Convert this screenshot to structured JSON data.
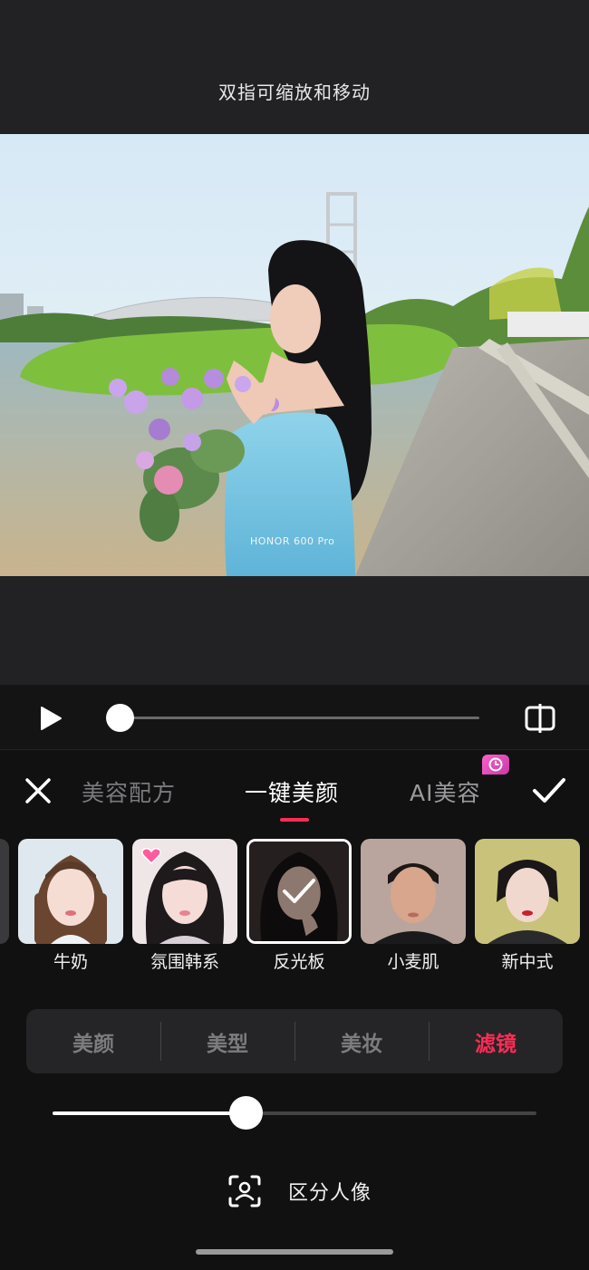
{
  "header": {
    "hint": "双指可缩放和移动"
  },
  "photo": {
    "watermark": "HONOR 600 Pro"
  },
  "playback": {
    "progress": 0.0
  },
  "tabs": [
    {
      "label": "美容配方",
      "active": false
    },
    {
      "label": "一键美颜",
      "active": true
    },
    {
      "label": "AI美容",
      "active": false,
      "badge_icon": "clock-icon"
    }
  ],
  "presets": [
    {
      "label": "牛奶",
      "selected": false
    },
    {
      "label": "氛围韩系",
      "selected": false,
      "badge_icon": "heart-icon"
    },
    {
      "label": "反光板",
      "selected": true
    },
    {
      "label": "小麦肌",
      "selected": false
    },
    {
      "label": "新中式",
      "selected": false
    }
  ],
  "categories": [
    {
      "label": "美颜",
      "active": false
    },
    {
      "label": "美型",
      "active": false
    },
    {
      "label": "美妆",
      "active": false
    },
    {
      "label": "滤镜",
      "active": true
    }
  ],
  "intensity": {
    "value": 0.4
  },
  "separate_portrait": {
    "label": "区分人像",
    "icon": "portrait-scan-icon"
  },
  "colors": {
    "accent": "#ff2c55",
    "badge": "#e24fbc"
  }
}
